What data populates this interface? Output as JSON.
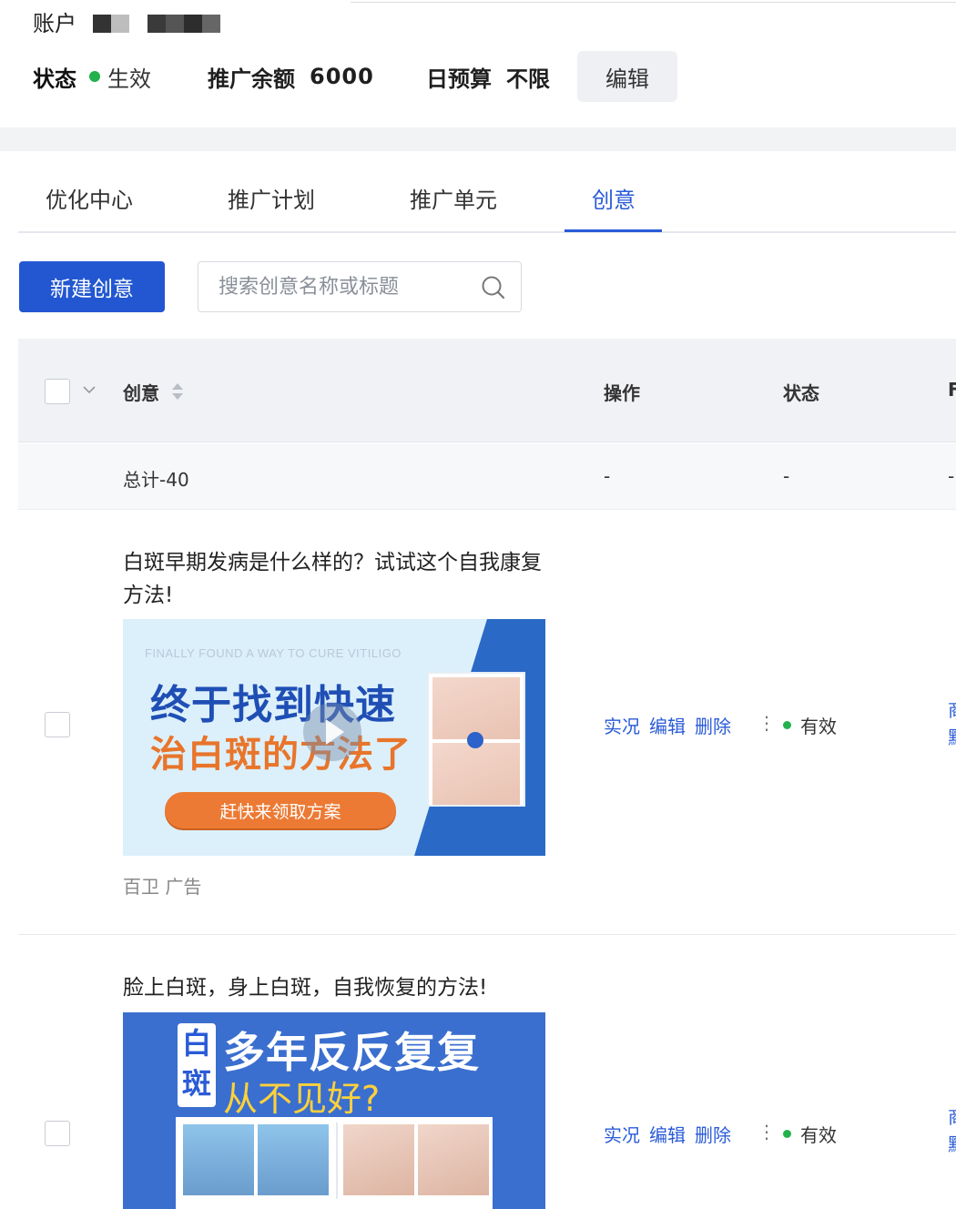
{
  "header": {
    "account_label": "账户",
    "status_label": "状态",
    "status_value": "生效",
    "balance_label": "推广余额",
    "balance_value": "6000",
    "budget_label": "日预算",
    "budget_value": "不限",
    "edit_label": "编辑"
  },
  "tabs": [
    {
      "label": "优化中心",
      "active": false
    },
    {
      "label": "推广计划",
      "active": false
    },
    {
      "label": "推广单元",
      "active": false
    },
    {
      "label": "创意",
      "active": true
    }
  ],
  "toolbar": {
    "new_label": "新建创意",
    "search_placeholder": "搜索创意名称或标题"
  },
  "table": {
    "columns": [
      "创意",
      "操作",
      "状态",
      "F"
    ],
    "total": {
      "label": "总计-40",
      "ops": "-",
      "status": "-",
      "edge": "-"
    },
    "rows": [
      {
        "title": "白斑早期发病是什么样的？试试这个自我康复方法!",
        "image": {
          "english": "FINALLY FOUND A WAY TO CURE VITILIGO",
          "line1": "终于找到快速",
          "line2": "治白斑的方法了",
          "cta": "赶快来领取方案"
        },
        "source": "百卫 广告",
        "ops": [
          "实况",
          "编辑",
          "删除"
        ],
        "more": "⋮",
        "status": "有效",
        "edge": [
          "商",
          "默"
        ]
      },
      {
        "title": "脸上白斑，身上白斑，自我恢复的方法!",
        "image": {
          "tag": "白斑",
          "line1": "多年反反复复",
          "line2": "从不见好?"
        },
        "ops": [
          "实况",
          "编辑",
          "删除"
        ],
        "more": "⋮",
        "status": "有效",
        "edge": [
          "商",
          "默"
        ]
      }
    ]
  },
  "colors": {
    "accent": "#2257d1",
    "link": "#2a5bd7",
    "success": "#22b14c"
  }
}
